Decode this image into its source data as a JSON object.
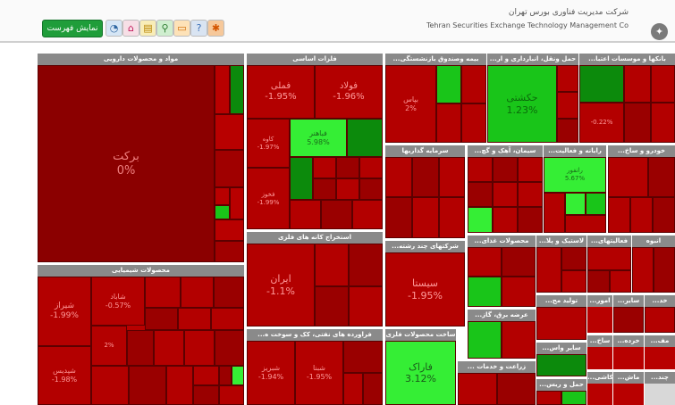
{
  "header": {
    "list_button": "نمایش فهرست",
    "company_fa": "شرکت مدیریت فناوری بورس تهران",
    "company_en": "Tehran Securities Exchange Technology Management Co",
    "toolbar_icons": [
      "help-icon",
      "chat-icon",
      "search-icon",
      "list-icon",
      "home-icon",
      "settings-icon"
    ]
  },
  "colors": {
    "deep_red": "#8b0000",
    "red": "#b80000",
    "light_red": "#c51111",
    "green": "#19c519",
    "bright_green": "#35ee35",
    "dark_green": "#0c8a0c",
    "header_grey": "#8a8a8a"
  },
  "sectors": [
    {
      "id": "pharma",
      "name": "مواد و محصولات دارویی",
      "stocks": [
        {
          "name": "برکت",
          "change": "0%"
        }
      ]
    },
    {
      "id": "metals",
      "name": "فلزات اساسی",
      "stocks": [
        {
          "name": "فملی",
          "change": "-1.95%"
        },
        {
          "name": "فولاد",
          "change": "-1.96%"
        },
        {
          "name": "فباهنر",
          "change": "5.98%"
        },
        {
          "name": "کاوه",
          "change": "-1.97%"
        },
        {
          "name": "فخوز",
          "change": "-1.99%"
        }
      ]
    },
    {
      "id": "insurance",
      "name": "...بیمه وصندوق بازنشستگی",
      "stocks": [
        {
          "name": "بپاس",
          "change": "2%"
        }
      ]
    },
    {
      "id": "transport",
      "name": "...حمل ونقل، انبارداری و ار",
      "stocks": [
        {
          "name": "حکشتی",
          "change": "1.23%"
        }
      ]
    },
    {
      "id": "banks",
      "name": "...بانکها و موسسات اعتبا",
      "stocks": [
        {
          "name": "",
          "change": "-0.22%"
        }
      ]
    },
    {
      "id": "investment",
      "name": "سرمایه گذاریها",
      "stocks": []
    },
    {
      "id": "cement",
      "name": "...سیمان، آهک و گچ",
      "stocks": []
    },
    {
      "id": "computer",
      "name": "...رایانه و فعالیت",
      "stocks": [
        {
          "name": "رانفور",
          "change": "5.67%"
        }
      ]
    },
    {
      "id": "auto",
      "name": "...خودرو و ساخ",
      "stocks": []
    },
    {
      "id": "mining",
      "name": "استخراج کانه های فلزی",
      "stocks": [
        {
          "name": "ایران",
          "change": "-1.1%"
        }
      ]
    },
    {
      "id": "multi",
      "name": "...شرکتهای چند رشته",
      "stocks": [
        {
          "name": "سیستا",
          "change": "-1.95%"
        }
      ]
    },
    {
      "id": "chemical",
      "name": "محصولات شیمیایی",
      "stocks": [
        {
          "name": "شیراز",
          "change": "-1.99%"
        },
        {
          "name": "شاباد",
          "change": "-0.57%"
        },
        {
          "name": "",
          "change": "2%"
        },
        {
          "name": "شپدیس",
          "change": "-1.98%"
        }
      ]
    },
    {
      "id": "petroleum",
      "name": "...فراورده های نفتی، کک و سوخت ه",
      "stocks": [
        {
          "name": "شبریز",
          "change": "-1.94%"
        },
        {
          "name": "شبنا",
          "change": "-1.95%"
        }
      ]
    },
    {
      "id": "metal_products",
      "name": "ساخت محصولات فلزی",
      "stocks": [
        {
          "name": "فاراک",
          "change": "3.12%"
        }
      ]
    },
    {
      "id": "food",
      "name": "...محصولات غذای",
      "stocks": []
    },
    {
      "id": "plastic",
      "name": "...لاستیک و پلا",
      "stocks": []
    },
    {
      "id": "general",
      "name": "...فعالیتهای",
      "stocks": []
    },
    {
      "id": "tile",
      "name": "انبوه",
      "stocks": []
    },
    {
      "id": "utility",
      "name": "...عرضه برق، گاز",
      "stocks": []
    },
    {
      "id": "equipment",
      "name": "...تولید مح",
      "stocks": []
    },
    {
      "id": "other_mining",
      "name": "...سایر واس",
      "stocks": []
    },
    {
      "id": "agri",
      "name": "... زراعت و خدمات",
      "stocks": []
    },
    {
      "id": "transport2",
      "name": "...حمل و ربس",
      "stocks": []
    }
  ],
  "misc_labels": [
    "...امور",
    "...خد",
    "...سایر",
    "...ساخ",
    "...ماش",
    "...چند",
    "...کاشی",
    "...خرده",
    "...مف"
  ]
}
